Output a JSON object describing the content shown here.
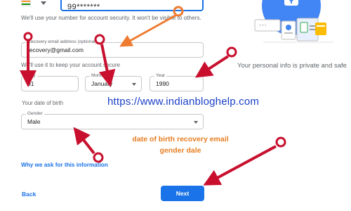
{
  "phone": {
    "value": "99*******"
  },
  "helper_text": "We'll use your number for account security. It won't be visible to others.",
  "recovery_email": {
    "label": "Recovery email address (optional)",
    "value": "recovery@gmail.com"
  },
  "recovery_note": "We'll use it to keep your account secure",
  "dob": {
    "day": {
      "label": "Day",
      "value": "01"
    },
    "month": {
      "label": "Month",
      "value": "January"
    },
    "year": {
      "label": "Year",
      "value": "1990"
    },
    "caption": "Your date of birth"
  },
  "gender": {
    "label": "Gender",
    "value": "Male"
  },
  "why_link": "Why we ask for this information",
  "back_label": "Back",
  "next_label": "Next",
  "privacy_text": "Your personal info is private and safe",
  "overlay": {
    "url": "https://www.indianbloghelp.com",
    "caption_line1": "date of birth  recovery  email",
    "caption_line2": "gender dale"
  },
  "colors": {
    "accent": "#1a73e8",
    "arrow_red": "#c8102e",
    "arrow_orange": "#ee7b30",
    "url_blue": "#1a3fc8"
  }
}
